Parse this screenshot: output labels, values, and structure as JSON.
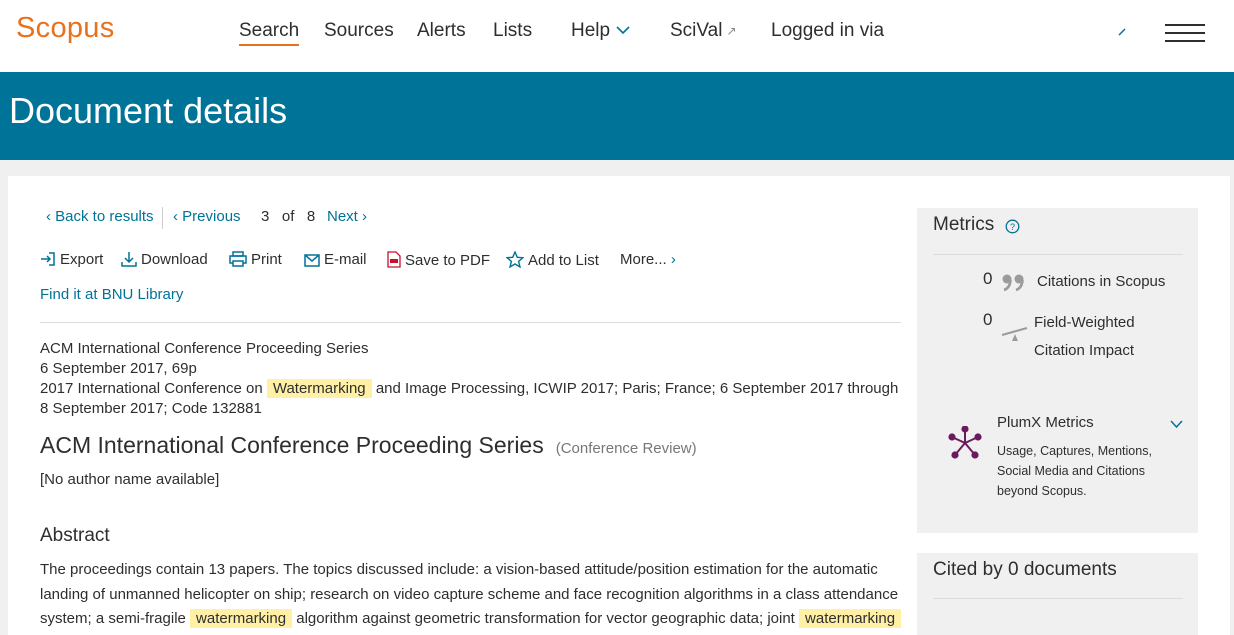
{
  "header": {
    "logo": "Scopus",
    "nav": {
      "search": "Search",
      "sources": "Sources",
      "alerts": "Alerts",
      "lists": "Lists",
      "help": "Help",
      "scival": "SciVal",
      "logged_in": "Logged in via"
    }
  },
  "banner": {
    "title": "Document details"
  },
  "navigation": {
    "back": "Back to results",
    "previous": "Previous",
    "current": "3",
    "of": "of",
    "total": "8",
    "next": "Next"
  },
  "actions": {
    "export": "Export",
    "download": "Download",
    "print": "Print",
    "email": "E-mail",
    "save_pdf": "Save to PDF",
    "add_list": "Add to List",
    "more": "More...",
    "find_it": "Find it at BNU Library"
  },
  "document": {
    "source": "ACM International Conference Proceeding Series",
    "date_pages": "6 September 2017, 69p",
    "conf_before": "2017 International Conference on",
    "conf_highlight": "Watermarking",
    "conf_after": "and Image Processing, ICWIP 2017; Paris; France; 6 September 2017 through 8 September 2017; Code 132881",
    "title": "ACM International Conference Proceeding Series",
    "type": "(Conference Review)",
    "authors": "[No author name available]"
  },
  "abstract": {
    "heading": "Abstract",
    "part1": "The proceedings contain 13 papers. The topics discussed include: a vision-based attitude/position estimation for the automatic landing of unmanned helicopter on ship; research on video capture scheme and face recognition algorithms in a class attendance system; a semi-fragile",
    "hl1": "watermarking",
    "part2": "algorithm against geometric transformation for vector geographic data; joint",
    "hl2": "watermarking"
  },
  "metrics": {
    "title": "Metrics",
    "citations_value": "0",
    "citations_label": "Citations in Scopus",
    "fwci_value": "0",
    "fwci_label_1": "Field-Weighted",
    "fwci_label_2": "Citation Impact",
    "plumx_title": "PlumX Metrics",
    "plumx_desc": "Usage, Captures, Mentions, Social Media and Citations beyond Scopus."
  },
  "cited_by": {
    "title": "Cited by 0 documents"
  },
  "colors": {
    "brand_orange": "#e9711c",
    "banner_teal": "#007398",
    "highlight": "#fff0a6",
    "plumx_purple": "#6b1a5e"
  }
}
